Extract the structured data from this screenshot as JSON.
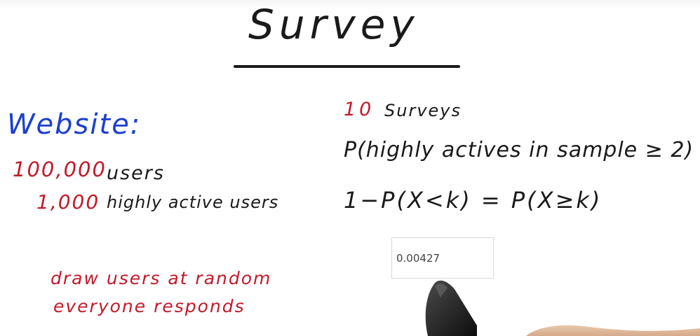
{
  "title": "Survey",
  "left_panel": {
    "heading": "Website:",
    "total_count": "100,000",
    "total_label": "users",
    "active_count": "1,000",
    "active_label": "highly active users"
  },
  "notes": {
    "line1": "draw users at random",
    "line2": "everyone responds"
  },
  "right_panel": {
    "surveys_count": "10",
    "surveys_label": "Surveys",
    "probability_expr": "P(highly actives in sample ≥ 2)",
    "formula": "1−P(X<k) = P(X≥k)"
  },
  "answer_input": {
    "value": "0.00427"
  },
  "colors": {
    "ink_black": "#1a1a1a",
    "ink_red": "#c21a2a",
    "ink_blue": "#1c3fd0"
  },
  "icons": {
    "marker": "marker-pen-icon"
  }
}
